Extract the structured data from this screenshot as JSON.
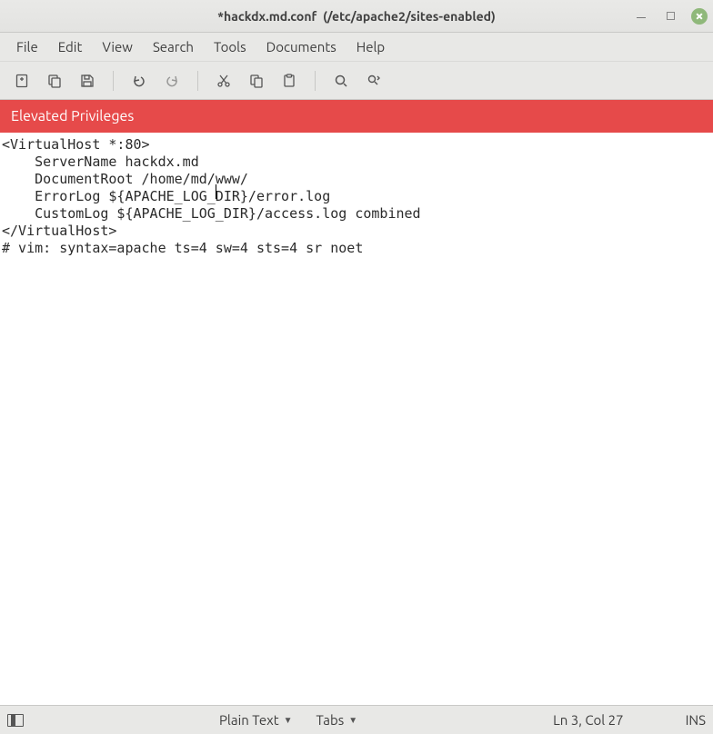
{
  "window": {
    "title_primary": "*hackdx.md.conf",
    "title_secondary": "(/etc/apache2/sites-enabled)"
  },
  "menus": [
    "File",
    "Edit",
    "View",
    "Search",
    "Tools",
    "Documents",
    "Help"
  ],
  "toolbar": {
    "icons": [
      "new-file-icon",
      "open-file-icon",
      "save-icon",
      "sep",
      "undo-icon",
      "redo-icon",
      "sep",
      "cut-icon",
      "copy-icon",
      "paste-icon",
      "sep",
      "search-icon",
      "find-replace-icon"
    ]
  },
  "banner": {
    "text": "Elevated Privileges"
  },
  "editor": {
    "lines": [
      "<VirtualHost *:80>",
      "    ServerName hackdx.md",
      "    DocumentRoot /home/md/www/",
      "",
      "    ErrorLog ${APACHE_LOG_DIR}/error.log",
      "    CustomLog ${APACHE_LOG_DIR}/access.log combined",
      "",
      "</VirtualHost>",
      "# vim: syntax=apache ts=4 sw=4 sts=4 sr noet"
    ],
    "cursor": {
      "line": 3,
      "col": 27
    }
  },
  "status": {
    "syntax": "Plain Text",
    "indent": "Tabs",
    "position": "Ln 3, Col 27",
    "insert_mode": "INS"
  }
}
